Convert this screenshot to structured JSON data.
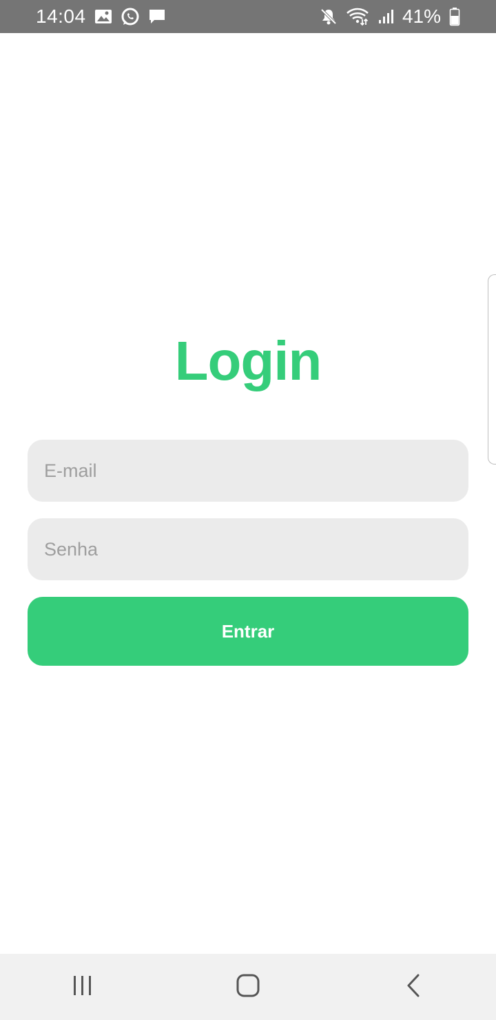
{
  "status_bar": {
    "time": "14:04",
    "battery_percent": "41%",
    "left_icons": [
      "gallery-icon",
      "whatsapp-icon",
      "message-icon"
    ],
    "right_icons": [
      "mute-icon",
      "wifi-icon",
      "signal-icon",
      "battery-icon"
    ],
    "background": "#757575"
  },
  "login": {
    "title": "Login",
    "email_placeholder": "E-mail",
    "password_placeholder": "Senha",
    "submit_label": "Entrar",
    "accent_color": "#35cd7a",
    "field_background": "#ebebeb"
  },
  "nav_bar": {
    "buttons": [
      "recent-apps-icon",
      "home-icon",
      "back-icon"
    ]
  }
}
